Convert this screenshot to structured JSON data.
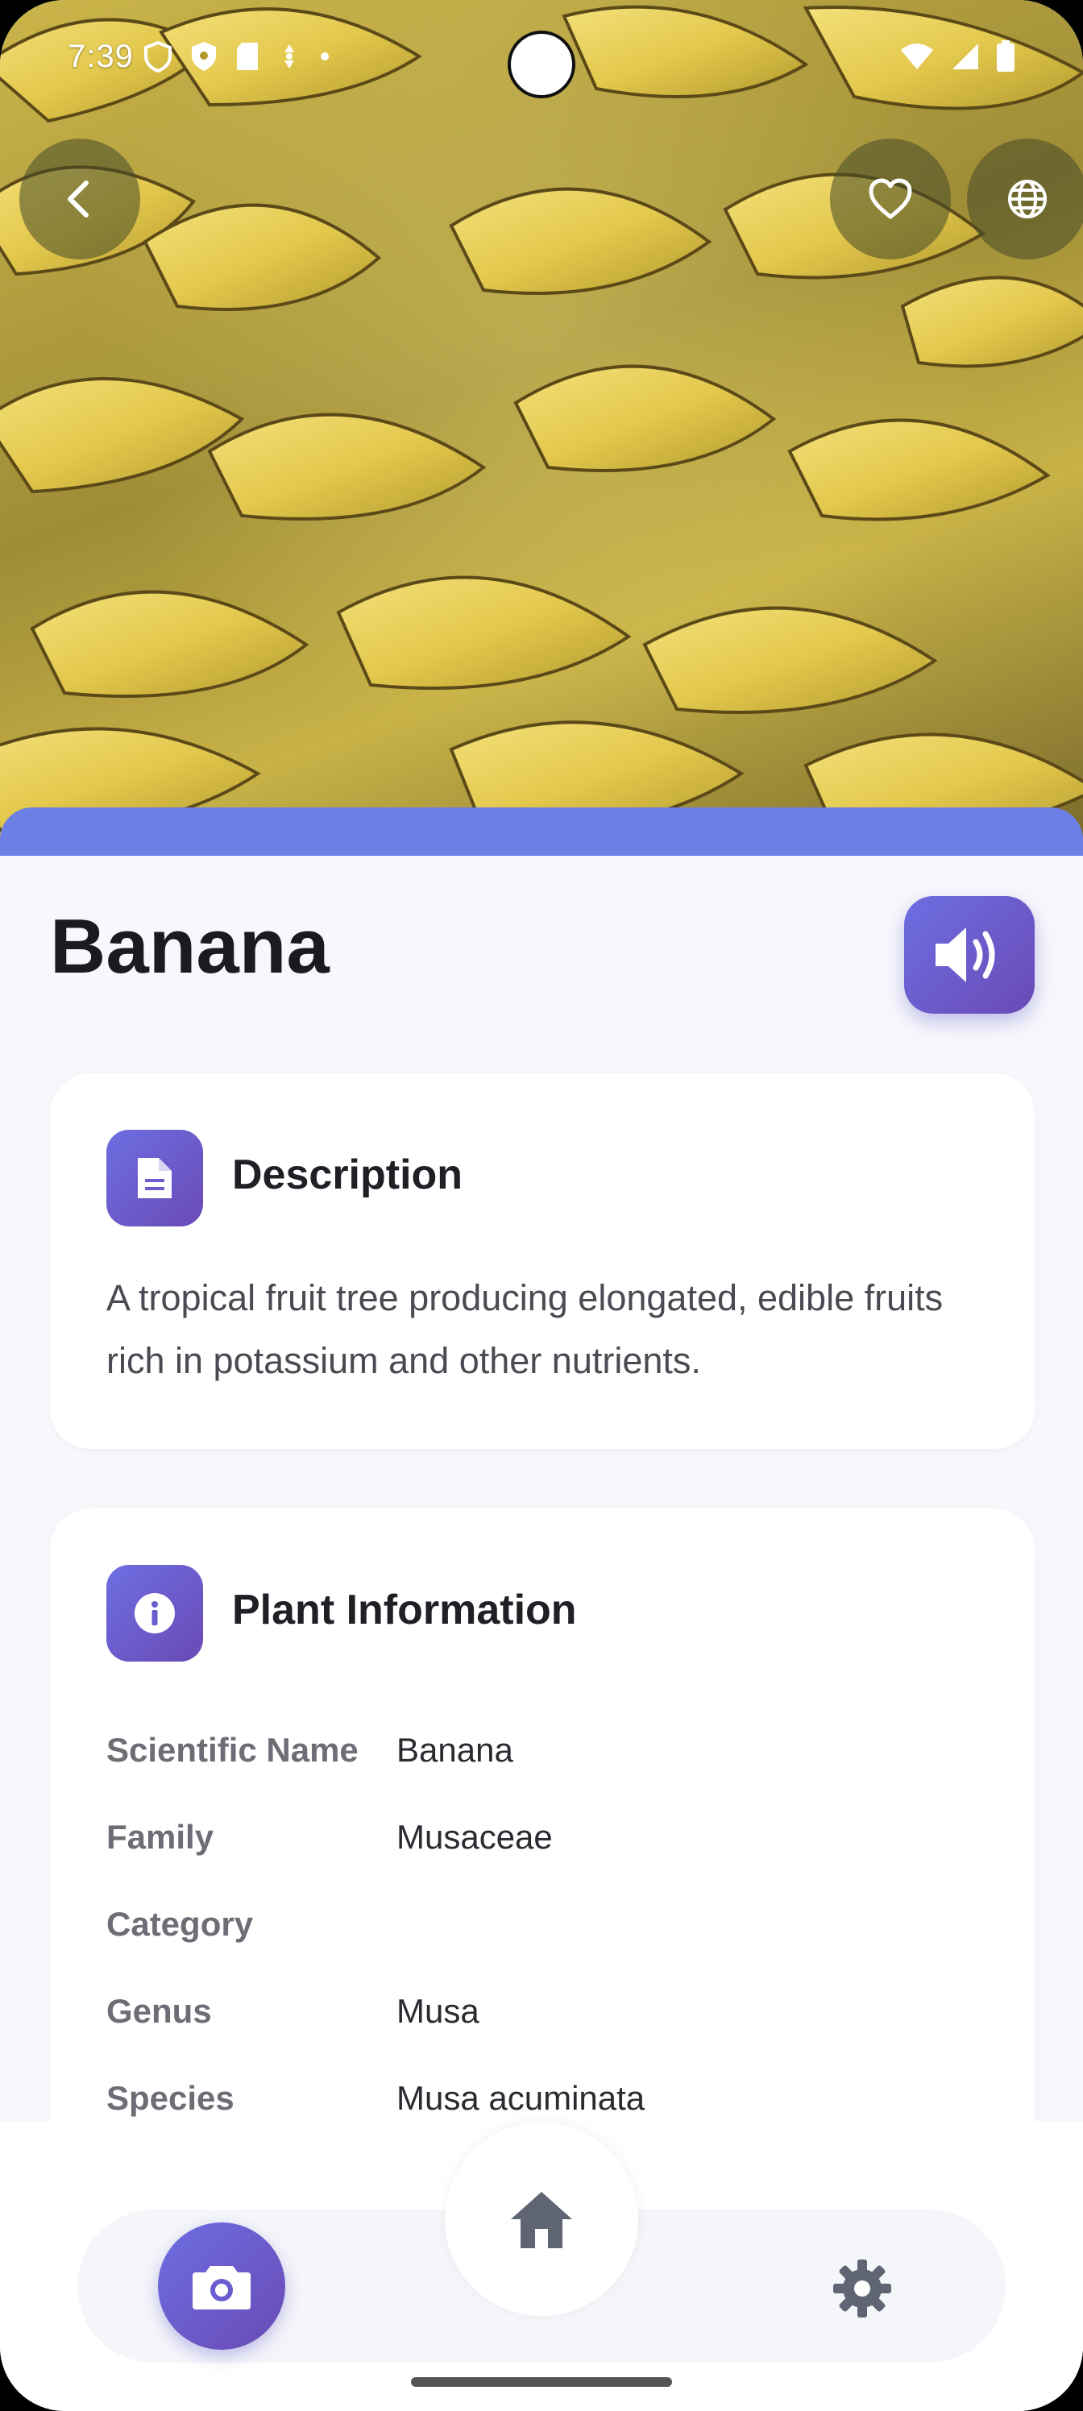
{
  "status_bar": {
    "time": "7:39",
    "left_icons": [
      "shield-outline-icon",
      "shield-icon",
      "sd-card-icon",
      "fan-icon",
      "dot-icon"
    ],
    "right_icons": [
      "wifi-icon",
      "signal-icon",
      "battery-icon"
    ]
  },
  "header": {
    "hero_image": "banana-bunches-photo",
    "back_icon": "chevron-left-icon",
    "favorite_icon": "heart-outline-icon",
    "language_icon": "globe-icon"
  },
  "plant": {
    "name": "Banana",
    "speak_icon": "volume-icon"
  },
  "description_card": {
    "title": "Description",
    "icon": "document-icon",
    "text": "A tropical fruit tree producing elongated, edible fruits rich in potassium and other nutrients."
  },
  "info_card": {
    "title": "Plant Information",
    "icon": "info-icon",
    "rows": [
      {
        "label": "Scientific Name",
        "value": "Banana"
      },
      {
        "label": "Family",
        "value": "Musaceae"
      },
      {
        "label": "Category",
        "value": ""
      },
      {
        "label": "Genus",
        "value": "Musa"
      },
      {
        "label": "Species",
        "value": "Musa acuminata"
      }
    ]
  },
  "bottom_nav": {
    "camera_icon": "camera-icon",
    "home_icon": "home-icon",
    "settings_icon": "gear-icon"
  },
  "colors": {
    "accent_start": "#6d6ee2",
    "accent_end": "#6a4ab5",
    "strip": "#6c7fe4",
    "background": "#f7f8fc"
  }
}
